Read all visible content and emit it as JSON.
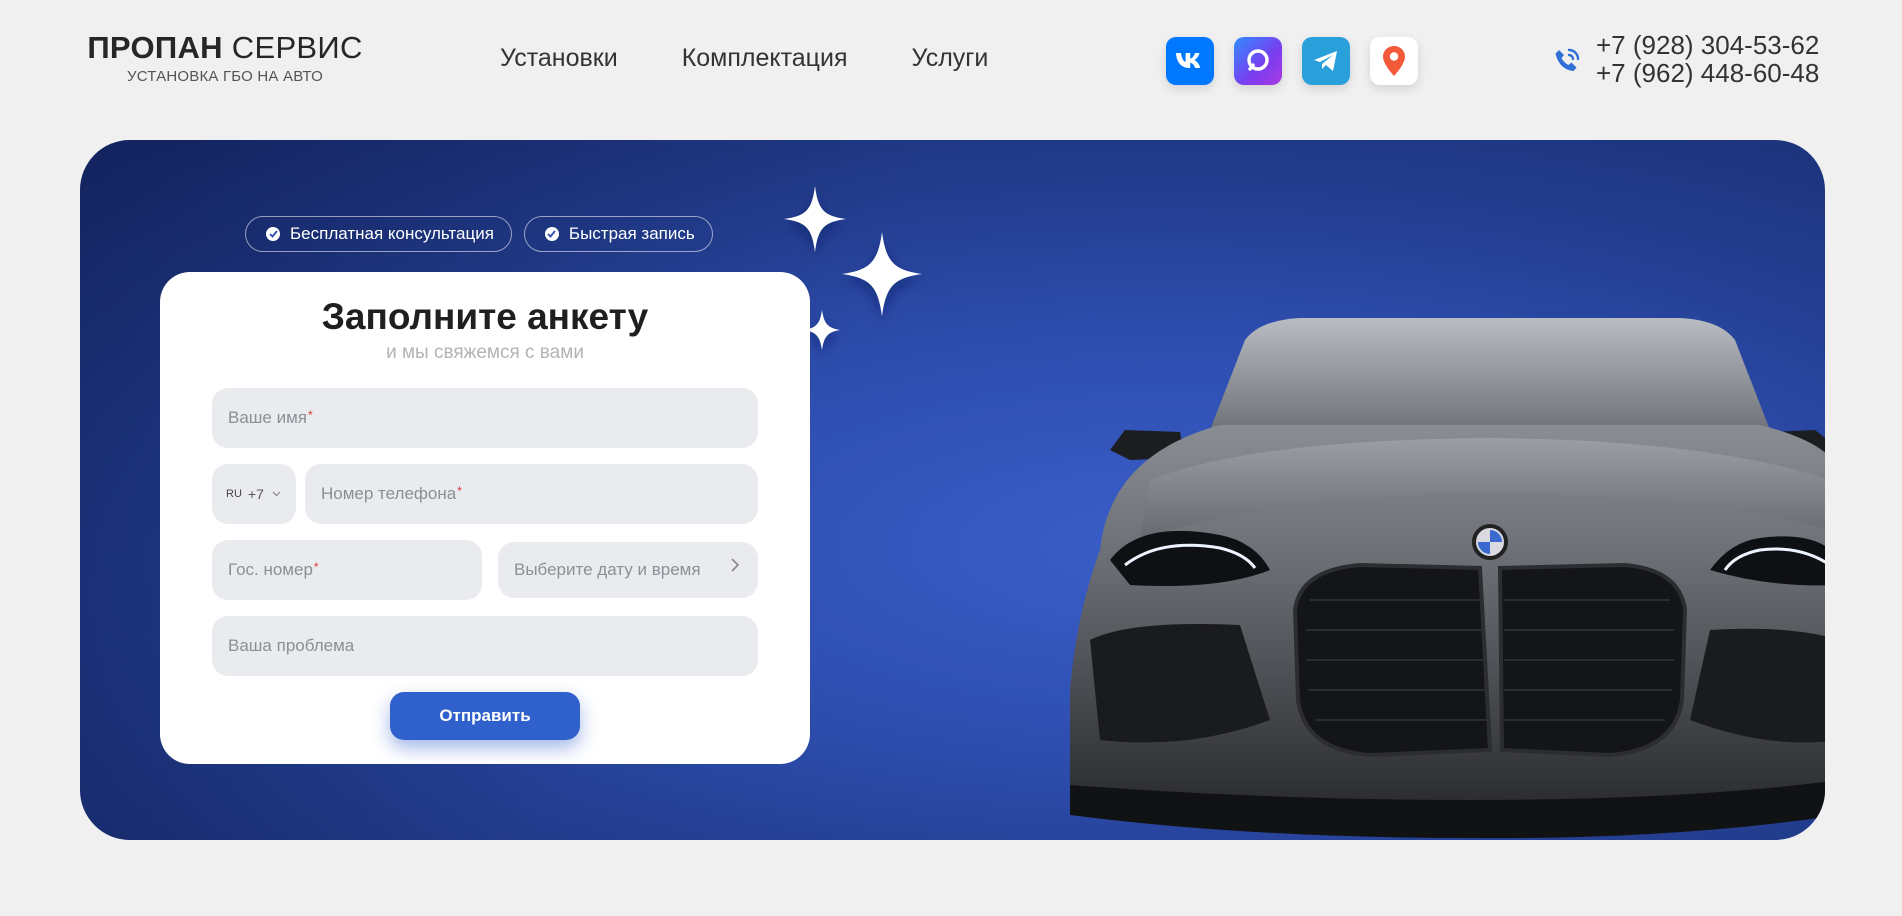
{
  "logo": {
    "brand_bold": "ПРОПАН",
    "brand_regular": "СЕРВИС",
    "subtitle": "УСТАНОВКА ГБО НА АВТО"
  },
  "nav": {
    "items": [
      {
        "label": "Установки"
      },
      {
        "label": "Комплектация"
      },
      {
        "label": "Услуги"
      }
    ]
  },
  "socials": [
    {
      "icon": "vk-icon",
      "label": "VK",
      "color": "#0077ff"
    },
    {
      "icon": "max-messenger-icon",
      "color": "#7b3cf0"
    },
    {
      "icon": "telegram-icon",
      "color": "#2aa0da"
    },
    {
      "icon": "map-pin-icon",
      "color": "#f25a3a"
    }
  ],
  "contacts": {
    "icon": "phone-icon",
    "phones": [
      "+7 (928) 304-53-62",
      "+7 (962) 448-60-48"
    ]
  },
  "hero": {
    "badges": [
      {
        "label": "Бесплатная консультация"
      },
      {
        "label": "Быстрая запись"
      }
    ],
    "form": {
      "title": "Заполните анкету",
      "subtitle": "и мы свяжемся с вами",
      "name_placeholder": "Ваше имя",
      "country_code": "RU",
      "dial_code": "+7",
      "phone_placeholder": "Номер телефона",
      "plate_placeholder": "Гос. номер",
      "datetime_placeholder": "Выберите дату и время",
      "problem_placeholder": "Ваша проблема",
      "required_mark": "*",
      "submit_label": "Отправить"
    }
  },
  "colors": {
    "accent": "#3060cc",
    "hero_bg": "#2e4eb0",
    "page_bg": "#f0f0f1"
  }
}
